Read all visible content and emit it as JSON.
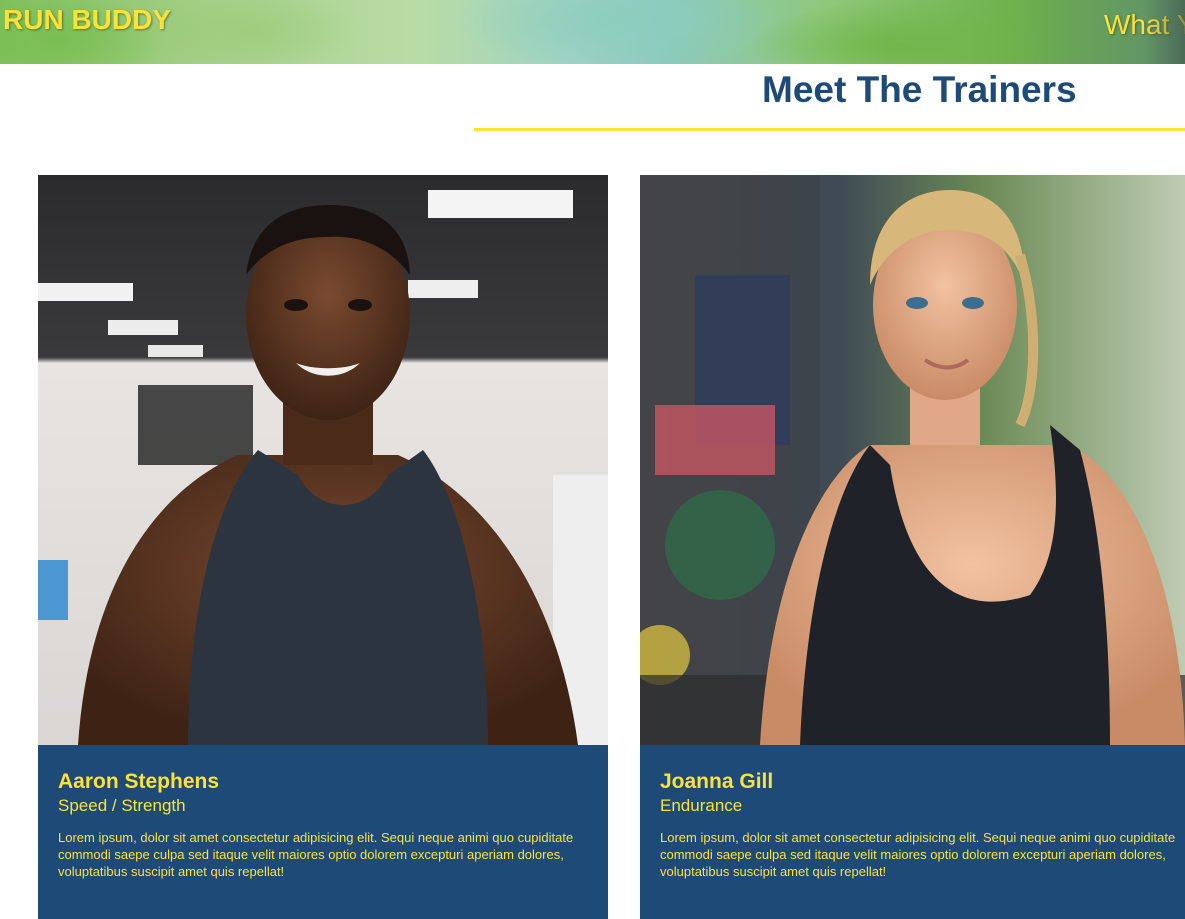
{
  "header": {
    "logo": "RUN BUDDY",
    "nav_link": "What You Do"
  },
  "section": {
    "title": "Meet The Trainers"
  },
  "trainers": [
    {
      "name": "Aaron Stephens",
      "role": "Speed / Strength",
      "bio": "Lorem ipsum, dolor sit amet consectetur adipisicing elit. Sequi neque animi quo cupiditate commodi saepe culpa sed itaque velit maiores optio dolorem excepturi aperiam dolores, voluptatibus suscipit amet quis repellat!"
    },
    {
      "name": "Joanna Gill",
      "role": "Endurance",
      "bio": "Lorem ipsum, dolor sit amet consectetur adipisicing elit. Sequi neque animi quo cupiditate commodi saepe culpa sed itaque velit maiores optio dolorem excepturi aperiam dolores, voluptatibus suscipit amet quis repellat!"
    }
  ],
  "colors": {
    "brand_yellow": "#fce138",
    "brand_blue": "#1e4a77"
  }
}
